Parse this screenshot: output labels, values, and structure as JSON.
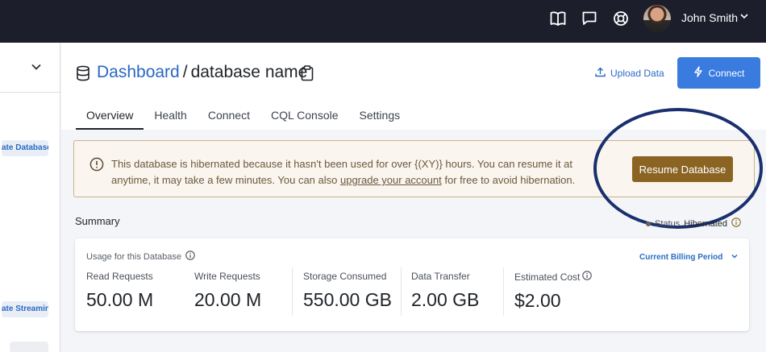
{
  "user": {
    "name": "John Smith"
  },
  "sidebar": {
    "pills": [
      "ate Database",
      "ate Streaming"
    ]
  },
  "header": {
    "breadcrumb_link": "Dashboard",
    "separator": "/",
    "database_name": "database name",
    "upload_label": "Upload Data",
    "connect_label": "Connect"
  },
  "tabs": [
    "Overview",
    "Health",
    "Connect",
    "CQL Console",
    "Settings"
  ],
  "banner": {
    "message_before": "This database is hibernated because it hasn't been used for over {(XY)} hours. You can resume it at anytime, it may take a few minutes. You can also ",
    "link_text": "upgrade your account",
    "message_after": " for free to avoid hibernation.",
    "resume_label": "Resume Database"
  },
  "summary": {
    "title": "Summary",
    "status_label": "Status",
    "status_value": "Hibernated",
    "usage_label": "Usage for this Database",
    "billing_label": "Current Billing Period",
    "metrics": [
      {
        "label": "Read Requests",
        "value": "50.00 M"
      },
      {
        "label": "Write Requests",
        "value": "20.00 M"
      },
      {
        "label": "Storage Consumed",
        "value": "550.00 GB"
      },
      {
        "label": "Data Transfer",
        "value": "2.00 GB"
      },
      {
        "label": "Estimated Cost",
        "value": "$2.00"
      }
    ]
  },
  "colors": {
    "primary": "#3a7be0",
    "link": "#2a67c4",
    "resume": "#8b6424",
    "topbar": "#1c1f2b",
    "highlight_ring": "#1a2f6e"
  },
  "icons": [
    "book-icon",
    "chat-icon",
    "help-lifebuoy-icon",
    "chevron-down-icon",
    "database-icon",
    "clipboard-icon",
    "upload-icon",
    "bolt-icon",
    "warning-icon",
    "info-icon"
  ]
}
